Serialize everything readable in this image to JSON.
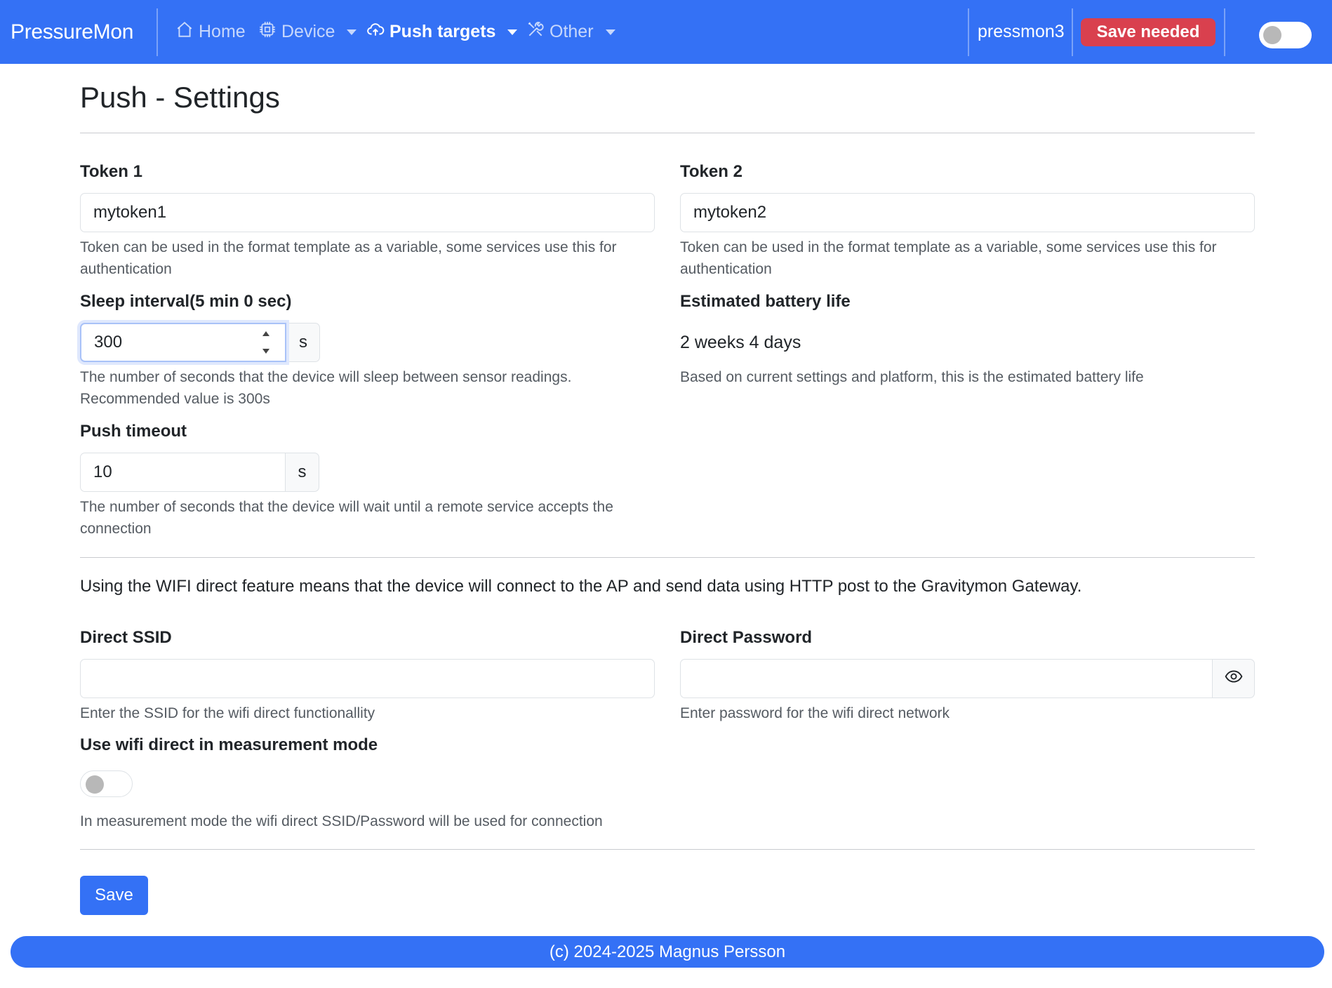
{
  "navbar": {
    "brand": "PressureMon",
    "items": [
      {
        "label": "Home",
        "icon": "home-icon"
      },
      {
        "label": "Device",
        "icon": "cpu-icon"
      },
      {
        "label": "Push targets",
        "icon": "cloud-upload-icon"
      },
      {
        "label": "Other",
        "icon": "tools-icon"
      }
    ],
    "hostname": "pressmon3",
    "save_needed": "Save needed"
  },
  "page": {
    "title": "Push - Settings"
  },
  "form": {
    "token1": {
      "label": "Token 1",
      "value": "mytoken1",
      "help": "Token can be used in the format template as a variable, some services use this for authentication"
    },
    "token2": {
      "label": "Token 2",
      "value": "mytoken2",
      "help": "Token can be used in the format template as a variable, some services use this for authentication"
    },
    "sleep_interval": {
      "label": "Sleep interval(5 min 0 sec)",
      "value": "300",
      "unit": "s",
      "help": "The number of seconds that the device will sleep between sensor readings. Recommended value is 300s"
    },
    "battery": {
      "label": "Estimated battery life",
      "value": "2 weeks 4 days",
      "help": "Based on current settings and platform, this is the estimated battery life"
    },
    "push_timeout": {
      "label": "Push timeout",
      "value": "10",
      "unit": "s",
      "help": "The number of seconds that the device will wait until a remote service accepts the connection"
    },
    "wifi_direct_info": "Using the WIFI direct feature means that the device will connect to the AP and send data using HTTP post to the Gravitymon Gateway.",
    "direct_ssid": {
      "label": "Direct SSID",
      "value": "",
      "help": "Enter the SSID for the wifi direct functionallity"
    },
    "direct_password": {
      "label": "Direct Password",
      "value": "",
      "help": "Enter password for the wifi direct network"
    },
    "wifi_direct_mode": {
      "label": "Use wifi direct in measurement mode",
      "enabled": false,
      "help": "In measurement mode the wifi direct SSID/Password will be used for connection"
    },
    "save_label": "Save"
  },
  "footer": {
    "text": "(c) 2024-2025 Magnus Persson"
  }
}
